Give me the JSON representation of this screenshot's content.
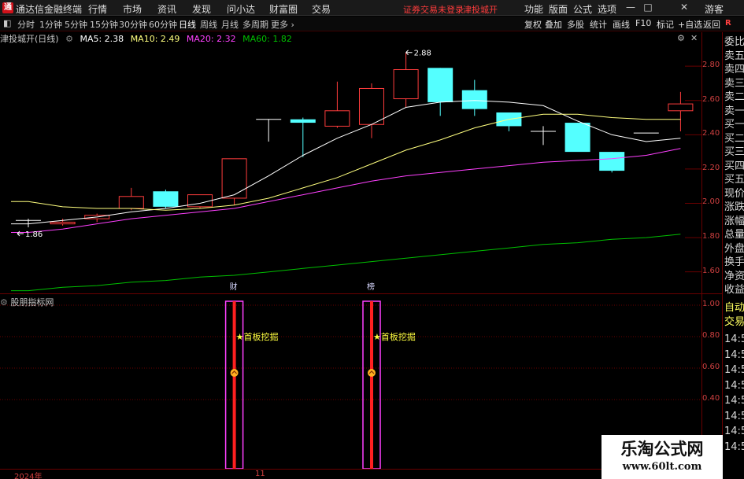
{
  "app": {
    "logo_glyph": "通",
    "title": "通达信金融终端"
  },
  "menu": [
    "行情",
    "市场",
    "资讯",
    "发现",
    "问小达",
    "财富圈",
    "交易"
  ],
  "status": {
    "login": "证券交易未登录",
    "stock": "津投城开"
  },
  "right_menu": [
    "功能",
    "版面",
    "公式",
    "选项",
    "游客"
  ],
  "window_controls": [
    "—",
    "□",
    "✕"
  ],
  "toolbar": {
    "periods": [
      "分时",
      "1分钟",
      "5分钟",
      "15分钟",
      "30分钟",
      "60分钟",
      "日线",
      "周线",
      "月线",
      "多周期",
      "更多 ›"
    ],
    "active_period": "日线",
    "buttons": [
      "复权",
      "叠加",
      "多股",
      "统计",
      "画线",
      "F10",
      "标记",
      "+自选",
      "返回"
    ],
    "sidebar_toggle": "R"
  },
  "chart_header": {
    "stock": "津投城开(日线)",
    "ma5": "MA5: 2.38",
    "ma10": "MA10: 2.49",
    "ma20": "MA20: 2.32",
    "ma60": "MA60: 1.82"
  },
  "indicator_header": {
    "name": "股朋指标网"
  },
  "colors": {
    "up": "#ff3c3c",
    "down": "#54ffff",
    "ma5": "#ffffff",
    "ma10": "#ffff7f",
    "ma20": "#ff40ff",
    "ma60": "#00c000",
    "axis": "#d04040",
    "grid": "#6a0000"
  },
  "quote_panel": [
    "委比",
    "卖五",
    "卖四",
    "卖三",
    "卖二",
    "卖一",
    "买一",
    "买二",
    "买三",
    "买四",
    "买五",
    "现价",
    "涨跌",
    "涨幅",
    "总量",
    "外盘",
    "换手",
    "净资",
    "收益",
    "自动",
    "交易",
    "14:5",
    "14:5",
    "14:5",
    "14:5",
    "14:5",
    "14:5",
    "14:5",
    "14:5"
  ],
  "chart_data": [
    {
      "type": "candlestick",
      "title": "津投城开(日线)",
      "y_ticks": [
        1.6,
        1.8,
        2.0,
        2.2,
        2.4,
        2.6,
        2.8
      ],
      "ylim": [
        1.47,
        2.92
      ],
      "candles": [
        {
          "o": 1.9,
          "h": 1.91,
          "l": 1.86,
          "c": 1.9
        },
        {
          "o": 1.88,
          "h": 1.91,
          "l": 1.87,
          "c": 1.89
        },
        {
          "o": 1.91,
          "h": 1.94,
          "l": 1.89,
          "c": 1.93
        },
        {
          "o": 1.97,
          "h": 2.09,
          "l": 1.96,
          "c": 2.04
        },
        {
          "o": 2.07,
          "h": 2.08,
          "l": 1.97,
          "c": 1.98
        },
        {
          "o": 1.98,
          "h": 2.05,
          "l": 1.97,
          "c": 2.05
        },
        {
          "o": 2.03,
          "h": 2.24,
          "l": 1.99,
          "c": 2.26
        },
        {
          "o": 2.49,
          "h": 2.49,
          "l": 2.36,
          "c": 2.49
        },
        {
          "o": 2.49,
          "h": 2.5,
          "l": 2.27,
          "c": 2.47
        },
        {
          "o": 2.45,
          "h": 2.71,
          "l": 2.44,
          "c": 2.54
        },
        {
          "o": 2.46,
          "h": 2.7,
          "l": 2.38,
          "c": 2.67
        },
        {
          "o": 2.61,
          "h": 2.88,
          "l": 2.56,
          "c": 2.78
        },
        {
          "o": 2.79,
          "h": 2.79,
          "l": 2.51,
          "c": 2.59
        },
        {
          "o": 2.66,
          "h": 2.72,
          "l": 2.51,
          "c": 2.55
        },
        {
          "o": 2.53,
          "h": 2.53,
          "l": 2.42,
          "c": 2.45
        },
        {
          "o": 2.42,
          "h": 2.45,
          "l": 2.34,
          "c": 2.42
        },
        {
          "o": 2.47,
          "h": 2.47,
          "l": 2.31,
          "c": 2.3
        },
        {
          "o": 2.3,
          "h": 2.3,
          "l": 2.18,
          "c": 2.19
        },
        {
          "o": 2.41,
          "h": 2.41,
          "l": 2.41,
          "c": 2.41
        },
        {
          "o": 2.54,
          "h": 2.65,
          "l": 2.42,
          "c": 2.58
        }
      ],
      "series": [
        {
          "name": "MA5",
          "color": "#ffffff",
          "values": [
            1.88,
            1.9,
            1.92,
            1.95,
            1.97,
            2.0,
            2.05,
            2.16,
            2.28,
            2.38,
            2.46,
            2.56,
            2.59,
            2.6,
            2.59,
            2.57,
            2.48,
            2.4,
            2.36,
            2.38
          ]
        },
        {
          "name": "MA10",
          "color": "#ffff7f",
          "values": [
            2.01,
            1.98,
            1.97,
            1.97,
            1.96,
            1.97,
            1.99,
            2.03,
            2.09,
            2.15,
            2.23,
            2.31,
            2.37,
            2.44,
            2.49,
            2.52,
            2.52,
            2.5,
            2.49,
            2.49
          ]
        },
        {
          "name": "MA20",
          "color": "#ff40ff",
          "values": [
            1.83,
            1.85,
            1.88,
            1.91,
            1.93,
            1.95,
            1.97,
            2.01,
            2.05,
            2.09,
            2.13,
            2.16,
            2.18,
            2.2,
            2.22,
            2.24,
            2.25,
            2.26,
            2.28,
            2.32
          ]
        },
        {
          "name": "MA60",
          "color": "#00c000",
          "values": [
            1.49,
            1.51,
            1.52,
            1.54,
            1.55,
            1.57,
            1.58,
            1.6,
            1.62,
            1.64,
            1.66,
            1.68,
            1.7,
            1.72,
            1.74,
            1.76,
            1.77,
            1.79,
            1.8,
            1.82
          ]
        }
      ],
      "annotations": {
        "high": "2.88",
        "low": "1.86",
        "markers": [
          {
            "index": 6,
            "text": "财"
          },
          {
            "index": 10,
            "text": "榜"
          }
        ]
      }
    },
    {
      "type": "bar",
      "title": "股朋指标网",
      "y_ticks": [
        0.4,
        0.6,
        0.8,
        1.0
      ],
      "ylim": [
        0,
        1.05
      ],
      "signals": [
        {
          "index": 6,
          "value": 1.0,
          "label": "★首板挖掘"
        },
        {
          "index": 10,
          "value": 1.0,
          "label": "★首板挖掘"
        }
      ]
    }
  ],
  "date_axis": [
    "2024年",
    "11"
  ],
  "watermark": {
    "title": "乐淘公式网",
    "url": "www.60lt.com"
  }
}
